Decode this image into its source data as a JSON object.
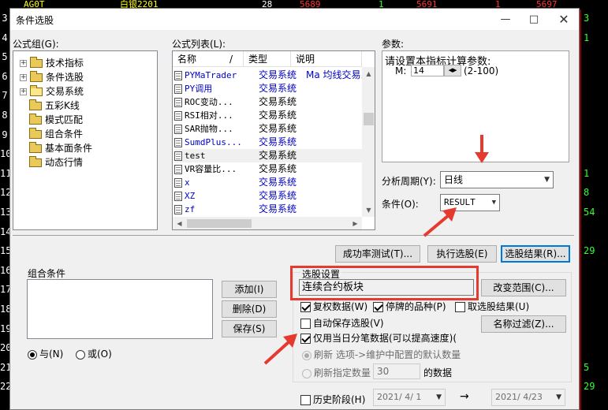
{
  "background": {
    "top_row": {
      "code": "AG0T",
      "name": "白银2201",
      "v1": "28",
      "v2": "5689",
      "v3": "1",
      "v4": "5691",
      "v5": "1",
      "v6": "5697"
    },
    "row_numbers": [
      "3",
      "4",
      "5",
      "6",
      "7",
      "8",
      "9",
      "10",
      "11",
      "12",
      "13",
      "14",
      "15",
      "16",
      "17",
      "18",
      "19",
      "20",
      "21",
      "22"
    ],
    "right_values": [
      "3",
      "1",
      "",
      "",
      "",
      "",
      "",
      "",
      "1",
      "8",
      "54",
      "",
      "29",
      "",
      "",
      "",
      "",
      "",
      "5",
      "29"
    ]
  },
  "dialog": {
    "title": "条件选股",
    "minimize": "—",
    "maximize": "□",
    "close": "✕"
  },
  "formula_group": {
    "label": "公式组(G):",
    "items": [
      {
        "label": "技术指标",
        "expander": "+"
      },
      {
        "label": "条件选股",
        "expander": "+"
      },
      {
        "label": "交易系统",
        "expander": "+"
      },
      {
        "label": "五彩K线",
        "expander": ""
      },
      {
        "label": "模式匹配",
        "expander": ""
      },
      {
        "label": "组合条件",
        "expander": ""
      },
      {
        "label": "基本面条件",
        "expander": ""
      },
      {
        "label": "动态行情",
        "expander": ""
      }
    ]
  },
  "formula_list": {
    "label": "公式列表(L):",
    "headers": {
      "name": "名称",
      "sort": "/",
      "type": "类型",
      "desc": "说明"
    },
    "rows": [
      {
        "name": "PYMaTrader",
        "type": "交易系统",
        "desc": "Ma 均线交易系统",
        "blue": true
      },
      {
        "name": "PY调用",
        "type": "交易系统",
        "desc": "",
        "blue": true
      },
      {
        "name": "ROC变动...",
        "type": "交易系统",
        "desc": "",
        "blue": false
      },
      {
        "name": "RSI相对...",
        "type": "交易系统",
        "desc": "",
        "blue": false
      },
      {
        "name": "SAR抛物...",
        "type": "交易系统",
        "desc": "",
        "blue": false
      },
      {
        "name": "SumdPlus...",
        "type": "交易系统",
        "desc": "",
        "blue": true
      },
      {
        "name": "test",
        "type": "交易系统",
        "desc": "",
        "blue": false
      },
      {
        "name": "VR容量比...",
        "type": "交易系统",
        "desc": "",
        "blue": false
      },
      {
        "name": "x",
        "type": "交易系统",
        "desc": "",
        "blue": true
      },
      {
        "name": "XZ",
        "type": "交易系统",
        "desc": "",
        "blue": true
      },
      {
        "name": "zf",
        "type": "交易系统",
        "desc": "",
        "blue": true
      }
    ]
  },
  "params": {
    "label": "参数:",
    "line1": "请设置本指标计算参数:",
    "m_label": "M:",
    "m_value": "14",
    "m_range": "(2-100)"
  },
  "period": {
    "label": "分析周期(Y):",
    "value": "日线"
  },
  "condition": {
    "label": "条件(O):",
    "value": "RESULT"
  },
  "buttons": {
    "success_test": "成功率测试(T)...",
    "execute": "执行选股(E)",
    "result": "选股结果(R)...",
    "add": "添加(I)",
    "delete": "删除(D)",
    "save": "保存(S)",
    "change_range": "改变范围(C)...",
    "name_filter": "名称过滤(Z)..."
  },
  "combo_condition": {
    "label": "组合条件",
    "and_label": "与(N)",
    "or_label": "或(O)"
  },
  "select_settings": {
    "label": "选股设置",
    "range_text": "连续合约板块",
    "rights": "复权数据(W)",
    "suspended": "停牌的品种(P)",
    "inverse": "取选股结果(U)",
    "autosave": "自动保存选股(V)",
    "tick_only": "仅用当日分笔数据(可以提高速度)(",
    "refresh_default": "刷新  选项->维护中配置的默认数量",
    "refresh_count": "刷新指定数量",
    "refresh_count_value": "30",
    "refresh_count_suffix": "的数据",
    "history": "历史阶段(H)",
    "date_from": "2021/ 4/ 1",
    "arrow": "→",
    "date_to": "2021/ 4/23"
  },
  "colors": {
    "accent": "#0078d7",
    "highlight": "#e53a2f",
    "system_blue": "#0000c8"
  }
}
